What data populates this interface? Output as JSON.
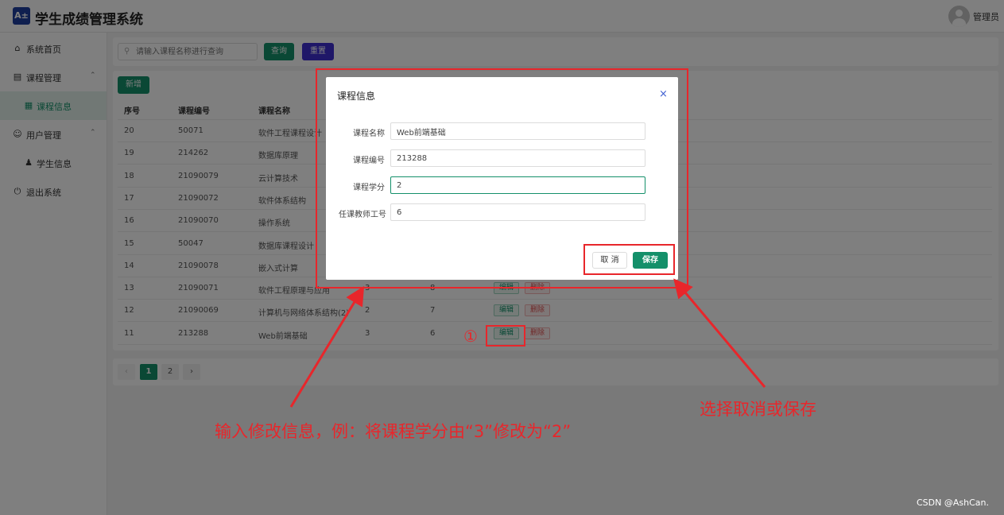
{
  "header": {
    "logo_text": "A±",
    "title": "学生成绩管理系统",
    "user": "管理员"
  },
  "sidebar": {
    "items": [
      {
        "label": "系统首页",
        "icon": "home-icon"
      },
      {
        "label": "课程管理",
        "icon": "book-icon"
      },
      {
        "label": "课程信息",
        "icon": "file-icon"
      },
      {
        "label": "用户管理",
        "icon": "user-icon"
      },
      {
        "label": "学生信息",
        "icon": "person-icon"
      },
      {
        "label": "退出系统",
        "icon": "power-icon"
      }
    ]
  },
  "search": {
    "placeholder": "请输入课程名称进行查询",
    "query_label": "查询",
    "reset_label": "重置"
  },
  "table": {
    "add_label": "新增",
    "columns": [
      "序号",
      "课程编号",
      "课程名称"
    ],
    "edit_label": "编辑",
    "delete_label": "删除",
    "rows": [
      {
        "id": "20",
        "code": "50071",
        "name": "软件工程课程设计",
        "credit": "",
        "teacher": ""
      },
      {
        "id": "19",
        "code": "214262",
        "name": "数据库原理",
        "credit": "",
        "teacher": ""
      },
      {
        "id": "18",
        "code": "21090079",
        "name": "云计算技术",
        "credit": "",
        "teacher": ""
      },
      {
        "id": "17",
        "code": "21090072",
        "name": "软件体系结构",
        "credit": "",
        "teacher": ""
      },
      {
        "id": "16",
        "code": "21090070",
        "name": "操作系统",
        "credit": "",
        "teacher": ""
      },
      {
        "id": "15",
        "code": "50047",
        "name": "数据库课程设计",
        "credit": "",
        "teacher": ""
      },
      {
        "id": "14",
        "code": "21090078",
        "name": "嵌入式计算",
        "credit": "",
        "teacher": ""
      },
      {
        "id": "13",
        "code": "21090071",
        "name": "软件工程原理与应用",
        "credit": "3",
        "teacher": "8"
      },
      {
        "id": "12",
        "code": "21090069",
        "name": "计算机与网络体系结构(2)",
        "credit": "2",
        "teacher": "7"
      },
      {
        "id": "11",
        "code": "213288",
        "name": "Web前端基础",
        "credit": "3",
        "teacher": "6"
      }
    ]
  },
  "pagination": {
    "prev": "‹",
    "pages": [
      "1",
      "2"
    ],
    "next": "›",
    "current": "1"
  },
  "modal": {
    "title": "课程信息",
    "close": "×",
    "fields": [
      {
        "label": "课程名称",
        "value": "Web前端基础"
      },
      {
        "label": "课程编号",
        "value": "213288"
      },
      {
        "label": "课程学分",
        "value": "2"
      },
      {
        "label": "任课教师工号",
        "value": "6"
      }
    ],
    "cancel_label": "取 消",
    "save_label": "保存"
  },
  "annotations": {
    "step_marker": "①",
    "edit_hint": "输入修改信息，例：将课程学分由“3”修改为“2”",
    "save_hint": "选择取消或保存",
    "color": "#e8262b"
  },
  "watermark": "CSDN @AshCan."
}
